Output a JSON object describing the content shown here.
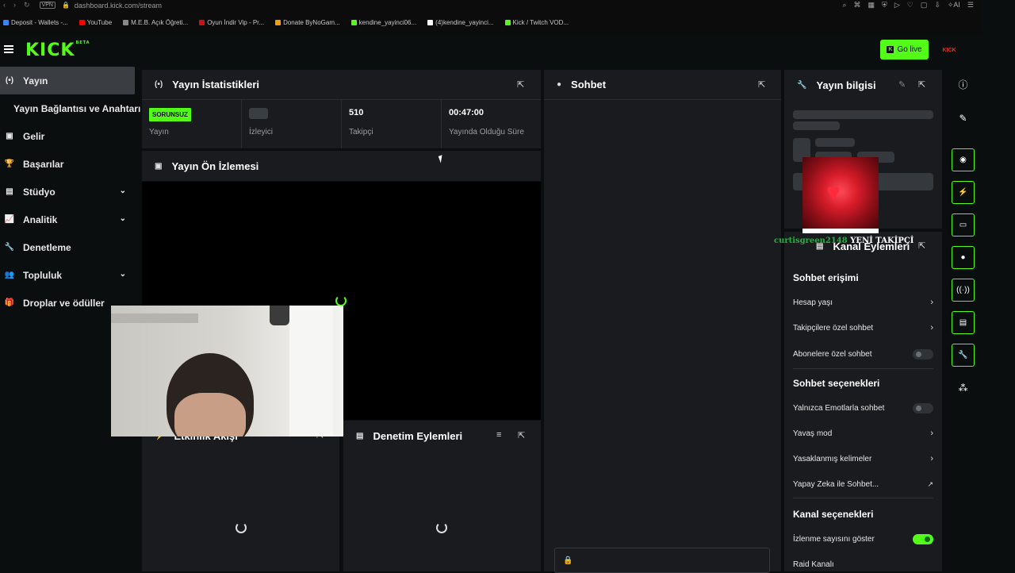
{
  "browser": {
    "url": "dashboard.kick.com/stream",
    "vpn_label": "VPN",
    "bookmarks": [
      {
        "label": "Deposit - Wallets -...",
        "color": "#3b82f6"
      },
      {
        "label": "YouTube",
        "color": "#ff0000"
      },
      {
        "label": "M.E.B. Açık Öğreti...",
        "color": "#888888"
      },
      {
        "label": "Oyun İndir Vip - Pr...",
        "color": "#cc1111"
      },
      {
        "label": "Donate ByNoGam...",
        "color": "#f59f00"
      },
      {
        "label": "kendine_yayinci06...",
        "color": "#53fc18"
      },
      {
        "label": "(4)kendine_yayinci...",
        "color": "#ffffff"
      },
      {
        "label": "Kick / Twitch VOD...",
        "color": "#53fc18"
      }
    ]
  },
  "header": {
    "logo": "KICK",
    "logo_sup": "BETA",
    "go_live": "Go live",
    "go_live_icon": "K",
    "avatar_text": "KICK"
  },
  "sidebar": {
    "items": [
      {
        "label": "Yayın",
        "icon": "broadcast-icon",
        "glyph": "(•)",
        "active": true
      },
      {
        "label": "Yayın Bağlantısı ve Anahtarı",
        "sub": true
      },
      {
        "label": "Gelir",
        "icon": "dollar-icon",
        "glyph": "▣"
      },
      {
        "label": "Başarılar",
        "icon": "trophy-icon",
        "glyph": "🏆"
      },
      {
        "label": "Stüdyo",
        "icon": "studio-icon",
        "glyph": "▤",
        "chevron": true
      },
      {
        "label": "Analitik",
        "icon": "analytics-icon",
        "glyph": "📈",
        "chevron": true
      },
      {
        "label": "Denetleme",
        "icon": "wrench-icon",
        "glyph": "🔧"
      },
      {
        "label": "Topluluk",
        "icon": "community-icon",
        "glyph": "👥",
        "chevron": true
      },
      {
        "label": "Droplar ve ödüller",
        "icon": "gift-icon",
        "glyph": "🎁"
      }
    ]
  },
  "stats": {
    "title": "Yayın İstatistikleri",
    "status_badge": "SORUNSUZ",
    "status_label": "Yayın",
    "viewers_label": "İzleyici",
    "followers_value": "510",
    "followers_label": "Takipçi",
    "uptime_value": "00:47:00",
    "uptime_label": "Yayında Olduğu Süre"
  },
  "preview": {
    "title": "Yayın Ön İzlemesi"
  },
  "activity": {
    "title": "Etkinlik Akışı"
  },
  "mod_actions": {
    "title": "Denetim Eylemleri"
  },
  "chat": {
    "title": "Sohbet"
  },
  "stream_info": {
    "title": "Yayın bilgisi"
  },
  "follower_alert": {
    "username": "curtisgreen2148",
    "text": "YENİ TAKİPÇİ"
  },
  "channel_actions": {
    "title": "Kanal Eylemleri",
    "chat_access": {
      "title": "Sohbet erişimi",
      "account_age": "Hesap yaşı",
      "followers_only": "Takipçilere özel sohbet",
      "subscribers_only": "Abonelere özel sohbet",
      "subscribers_only_on": false
    },
    "chat_options": {
      "title": "Sohbet seçenekleri",
      "emote_only": "Yalnızca Emotlarla sohbet",
      "emote_only_on": false,
      "slow_mode": "Yavaş mod",
      "banned_words": "Yasaklanmış kelimeler",
      "ai_chat": "Yapay Zeka ile Sohbet..."
    },
    "channel_options": {
      "title": "Kanal seçenekleri",
      "show_viewcount": "İzlenme sayısını göster",
      "show_viewcount_on": true,
      "raid": "Raid Kanalı"
    }
  },
  "rail": {
    "info": "ⓘ",
    "edit": "✎",
    "items": [
      {
        "icon": "eye-icon",
        "glyph": "◉"
      },
      {
        "icon": "lightning-icon",
        "glyph": "⚡"
      },
      {
        "icon": "note-icon",
        "glyph": "▭"
      },
      {
        "icon": "chat-bubble-icon",
        "glyph": "●"
      },
      {
        "icon": "broadcast-icon",
        "glyph": "((·))"
      },
      {
        "icon": "layout-icon",
        "glyph": "▤"
      },
      {
        "icon": "wrench-icon",
        "glyph": "🔧"
      }
    ],
    "more": "⁂"
  },
  "colors": {
    "accent": "#53fc18",
    "panel": "#191b1f",
    "bg": "#0b0e0f"
  }
}
